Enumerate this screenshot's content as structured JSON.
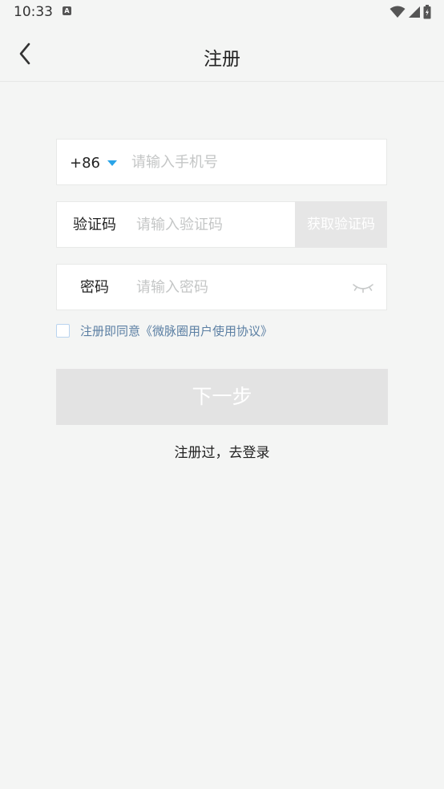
{
  "status_bar": {
    "time": "10:33",
    "notification_icon": "accessibility-a-icon",
    "icons": [
      "wifi-icon",
      "signal-icon",
      "battery-icon"
    ]
  },
  "header": {
    "title": "注册",
    "back_icon": "chevron-left-icon"
  },
  "form": {
    "phone": {
      "country_code": "+86",
      "placeholder": "请输入手机号",
      "value": ""
    },
    "code": {
      "label": "验证码",
      "placeholder": "请输入验证码",
      "value": "",
      "get_code_label": "获取验证码"
    },
    "password": {
      "label": "密码",
      "placeholder": "请输入密码",
      "value": "",
      "visibility_icon": "eye-closed-icon"
    },
    "agreement": {
      "prefix": "注册即同意",
      "link": "《微脉圈用户使用协议》",
      "checked": false
    }
  },
  "actions": {
    "next_label": "下一步",
    "login_link": "注册过，去登录"
  },
  "colors": {
    "background": "#f4f5f4",
    "accent": "#2aa4e8",
    "link": "#5b7fa3",
    "disabled_button": "#e3e3e3",
    "placeholder": "#c4c6c6"
  }
}
